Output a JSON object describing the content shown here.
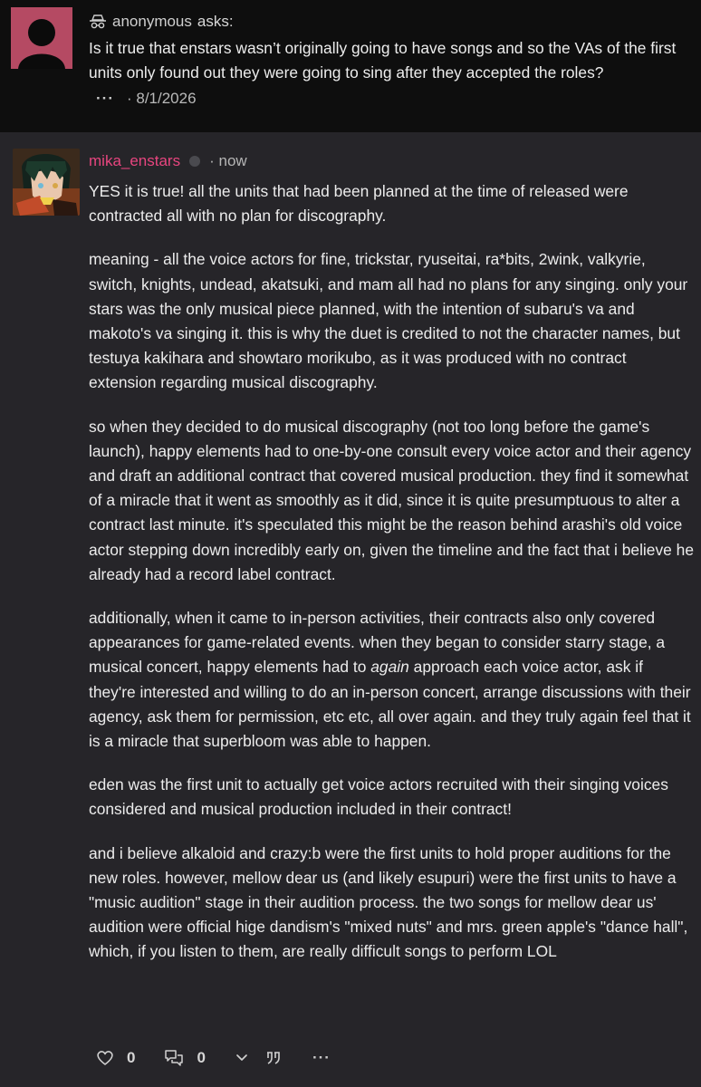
{
  "ask": {
    "username": "anonymous",
    "asks_label": "asks:",
    "question": "Is it true that enstars wasn’t originally going to have songs and so the VAs of the first units only found out they were going to sing after they accepted the roles?",
    "more": "···",
    "date": "· 8/1/2026"
  },
  "answer": {
    "username": "mika_enstars",
    "time": "· now",
    "p1": "YES it is true! all the units that had been planned at the time of released were contracted all with no plan for discography.",
    "p2": "meaning - all the voice actors for fine, trickstar, ryuseitai, ra*bits, 2wink, valkyrie, switch, knights, undead, akatsuki, and mam all had no plans for any singing. only your stars was the only musical piece planned, with the intention of subaru's va and makoto's va singing it. this is why the duet is credited to not the character names, but testuya kakihara and showtaro morikubo, as it was produced with no contract extension regarding musical discography.",
    "p3": "so when they decided to do musical discography (not too long before the game's launch), happy elements had to one-by-one consult every voice actor and their agency and draft an additional contract that covered musical production. they find it somewhat of a miracle that it went as smoothly as it did, since it is quite presumptuous to alter a contract last minute. it's speculated this might be the reason behind arashi's old voice actor stepping down incredibly early on, given the timeline and the fact that i believe he already had a record label contract.",
    "p4_a": "additionally, when it came to in-person activities, their contracts also only covered appearances for game-related events. when they began to consider starry stage, a musical concert, happy elements had to ",
    "p4_em": "again",
    "p4_b": " approach each voice actor, ask if they're interested and willing to do an in-person concert, arrange discussions with their agency, ask them for permission, etc etc, all over again. and they truly again feel that it is a miracle that superbloom was able to happen.",
    "p5": "eden was the first unit to actually get voice actors recruited with their singing voices considered and musical production included in their contract!",
    "p6": "and i believe alkaloid and crazy:b were the first units to hold proper auditions for the new roles. however, mellow dear us (and likely esupuri) were the first units to have a \"music audition\" stage in their audition process. the two songs for mellow dear us' audition were official hige dandism's \"mixed nuts\" and mrs. green apple's \"dance hall\", which, if you listen to them, are really difficult songs to perform LOL"
  },
  "actions": {
    "likes": "0",
    "comments": "0",
    "more": "···"
  },
  "colors": {
    "accent": "#e8457f",
    "ask_bg": "#0e0e0e",
    "answer_bg": "#262529",
    "ask_avatar": "#b54a63"
  },
  "icons": [
    "incognito-icon",
    "heart-icon",
    "comment-icon",
    "chevron-down-icon",
    "quote-icon",
    "more-icon"
  ]
}
